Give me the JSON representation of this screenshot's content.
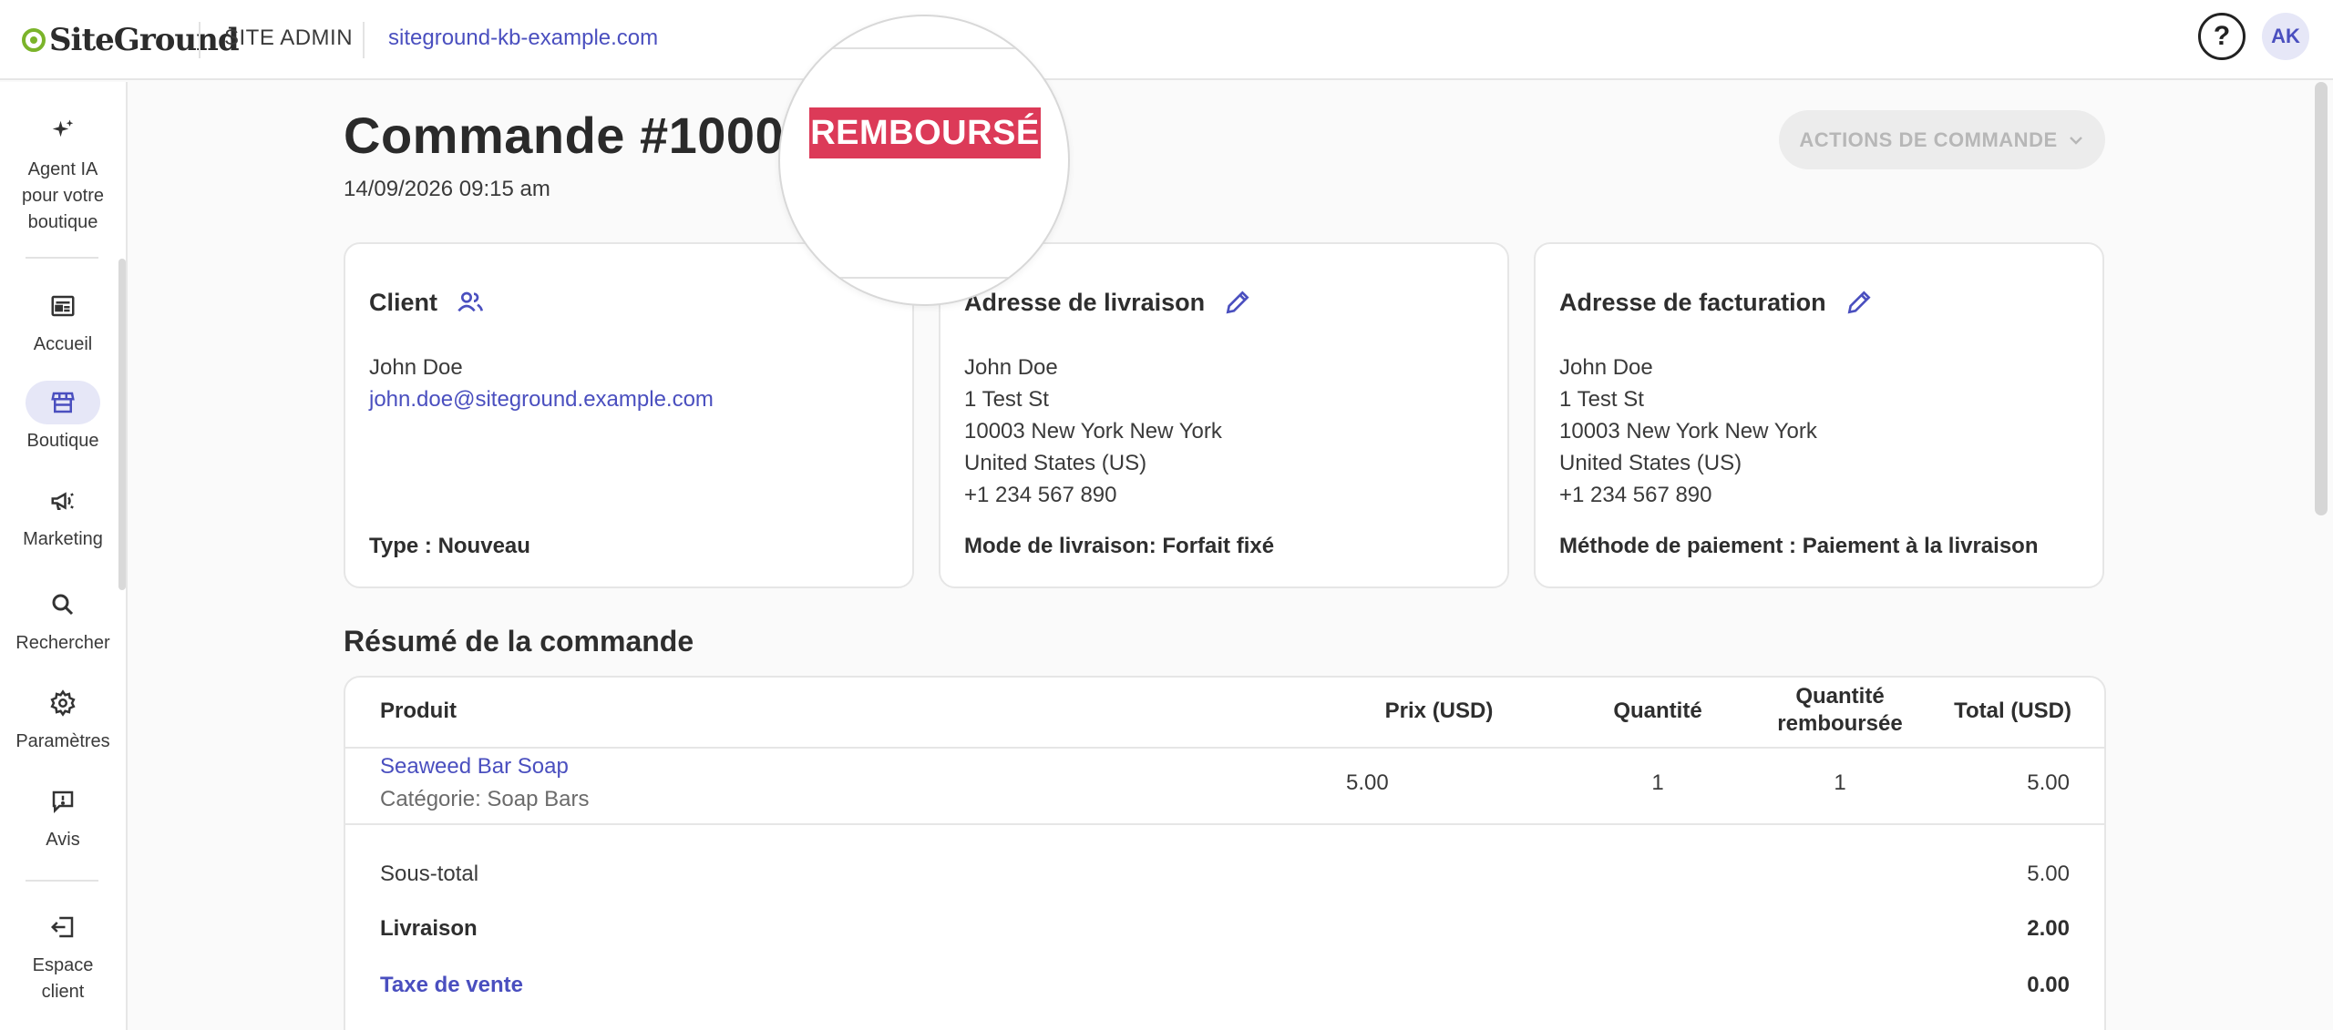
{
  "topbar": {
    "logo_text": "SiteGround",
    "section": "SITE ADMIN",
    "domain": "siteground-kb-example.com",
    "help_glyph": "?",
    "avatar_initials": "AK"
  },
  "sidebar": {
    "items": [
      {
        "label": "Agent IA pour votre boutique",
        "icon": "sparkle-icon"
      },
      {
        "label": "Accueil",
        "icon": "dashboard-icon"
      },
      {
        "label": "Boutique",
        "icon": "store-icon",
        "active": true
      },
      {
        "label": "Marketing",
        "icon": "megaphone-icon"
      },
      {
        "label": "Rechercher",
        "icon": "search-icon"
      },
      {
        "label": "Paramètres",
        "icon": "gear-icon"
      },
      {
        "label": "Avis",
        "icon": "review-icon"
      },
      {
        "label": "Espace client",
        "icon": "logout-icon"
      }
    ]
  },
  "order": {
    "title": "Commande #10000",
    "status_badge": "REMBOURSÉ",
    "date": "14/09/2026 09:15 am",
    "actions_label": "ACTIONS DE COMMANDE"
  },
  "cards": {
    "client": {
      "title": "Client",
      "name": "John Doe",
      "email": "john.doe@siteground.example.com",
      "footer": "Type : Nouveau"
    },
    "shipping": {
      "title": "Adresse de livraison",
      "lines": [
        "John Doe",
        "1 Test St",
        "10003 New York New York",
        "United States (US)",
        "+1 234 567 890"
      ],
      "footer": "Mode de livraison: Forfait fixé"
    },
    "billing": {
      "title": "Adresse de facturation",
      "lines": [
        "John Doe",
        "1 Test St",
        "10003 New York New York",
        "United States (US)",
        "+1 234 567 890"
      ],
      "footer": "Méthode de paiement : Paiement à la livraison"
    }
  },
  "summary": {
    "title": "Résumé de la commande",
    "columns": {
      "product": "Produit",
      "price": "Prix (USD)",
      "qty": "Quantité",
      "refunded": "Quantité remboursée",
      "total": "Total (USD)"
    },
    "rows": [
      {
        "product": "Seaweed Bar Soap",
        "category": "Catégorie: Soap Bars",
        "price": "5.00",
        "qty": "1",
        "refunded": "1",
        "total": "5.00"
      }
    ],
    "totals": {
      "subtotal_label": "Sous-total",
      "subtotal": "5.00",
      "shipping_label": "Livraison",
      "shipping": "2.00",
      "tax_label": "Taxe de vente",
      "tax": "0.00"
    }
  },
  "colors": {
    "accent": "#4a4fbf",
    "badge_refunded": "#dc3a58",
    "logo_green": "#7bb42a"
  }
}
